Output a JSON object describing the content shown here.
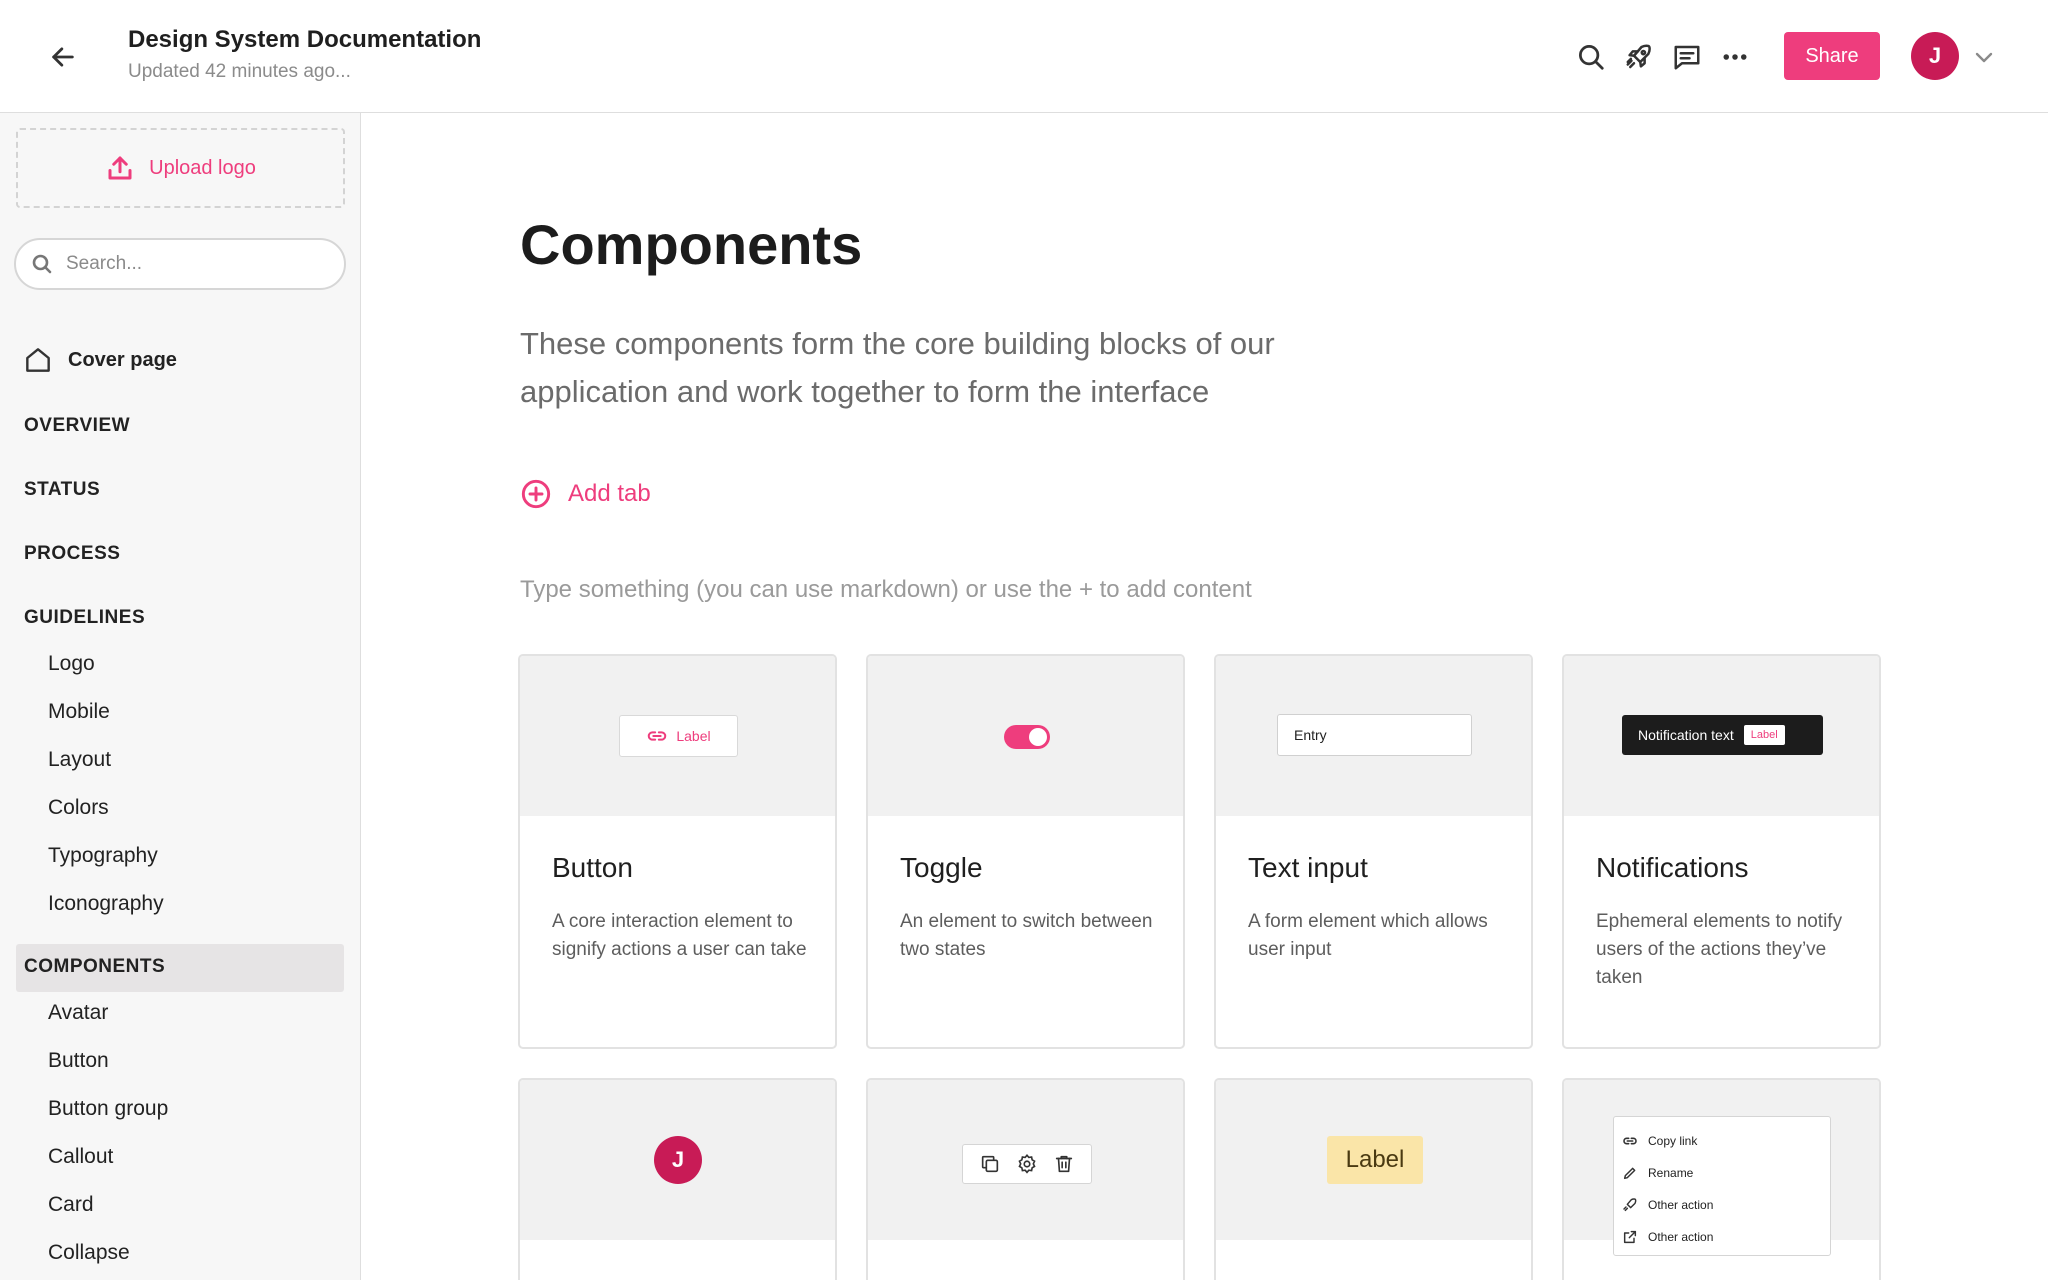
{
  "header": {
    "title": "Design System Documentation",
    "subtitle": "Updated 42 minutes ago...",
    "share_label": "Share",
    "avatar_initial": "J",
    "icons": [
      "arrow-left-icon",
      "search-icon",
      "rocket-icon",
      "comment-icon",
      "more-icon",
      "chevron-down-icon"
    ]
  },
  "sidebar": {
    "upload_label": "Upload logo",
    "search_placeholder": "Search...",
    "cover_label": "Cover page",
    "sections": [
      {
        "label": "OVERVIEW"
      },
      {
        "label": "STATUS"
      },
      {
        "label": "PROCESS"
      },
      {
        "label": "GUIDELINES",
        "items": [
          "Logo",
          "Mobile",
          "Layout",
          "Colors",
          "Typography",
          "Iconography"
        ]
      },
      {
        "label": "COMPONENTS",
        "active": true,
        "items": [
          "Avatar",
          "Button",
          "Button group",
          "Callout",
          "Card",
          "Collapse"
        ]
      }
    ]
  },
  "main": {
    "heading": "Components",
    "description": "These components form the core building blocks of our application and work together to form the interface",
    "add_tab_label": "Add tab",
    "hint": "Type something (you can use markdown) or use the + to add content",
    "cards": [
      {
        "title": "Button",
        "description": "A core interaction element to signify actions a user can take",
        "preview_label": "Label"
      },
      {
        "title": "Toggle",
        "description": "An element to switch between two states"
      },
      {
        "title": "Text input",
        "description": "A form element which allows user input",
        "preview_value": "Entry"
      },
      {
        "title": "Notifications",
        "description": "Ephemeral elements to notify users of the actions they’ve taken",
        "preview_text": "Notification text",
        "preview_label": "Label"
      },
      {
        "title": "",
        "description": "",
        "preview_initial": "J"
      },
      {
        "title": "",
        "description": ""
      },
      {
        "title": "",
        "description": "",
        "preview_label": "Label"
      },
      {
        "title": "",
        "description": "",
        "menu_items": [
          "Copy link",
          "Rename",
          "Other action",
          "Other action"
        ]
      }
    ]
  },
  "colors": {
    "accent": "#ee3d7d",
    "avatar": "#c81b56",
    "sidebar_bg": "#f7f7f7",
    "active_item_bg": "#e6e4e5",
    "badge_bg": "#fae5a8"
  }
}
